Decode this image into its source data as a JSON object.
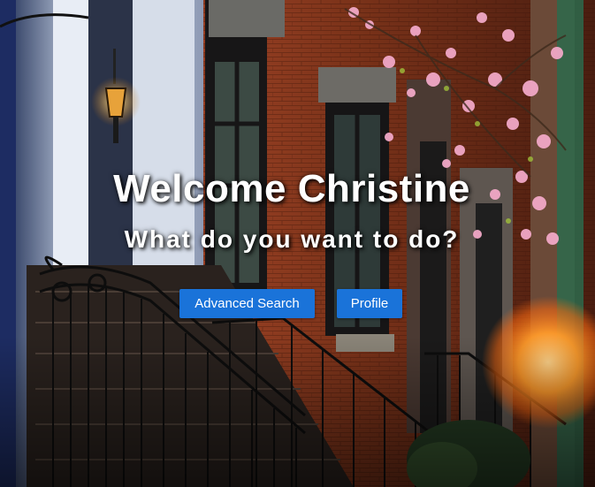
{
  "hero": {
    "title": "Welcome Christine",
    "subtitle": "What do you want to do?"
  },
  "actions": {
    "advanced_search_label": "Advanced Search",
    "profile_label": "Profile"
  },
  "colors": {
    "button_bg": "#1a73d9",
    "button_text": "#ffffff",
    "heading_text": "#ffffff",
    "brick": "#8a3a22",
    "lens_flare": "#ff8a1a"
  }
}
